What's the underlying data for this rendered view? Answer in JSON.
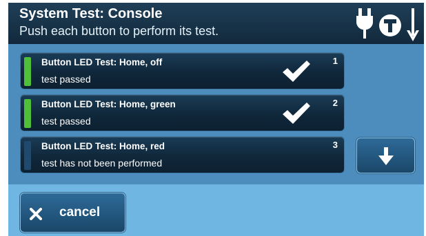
{
  "header": {
    "title": "System Test: Console",
    "subtitle": "Push each button to perform its test.",
    "icons": [
      "power-plug-icon",
      "t-circle-icon",
      "arrow-down-icon"
    ]
  },
  "tests": [
    {
      "title": "Button LED Test: Home, off",
      "status": "test passed",
      "number": "1",
      "state": "passed"
    },
    {
      "title": "Button LED Test: Home, green",
      "status": "test passed",
      "number": "2",
      "state": "passed"
    },
    {
      "title": "Button LED Test: Home, red",
      "status": "test has not been performed",
      "number": "3",
      "state": "pending"
    }
  ],
  "scroll": {
    "icon": "arrow-down-icon"
  },
  "footer": {
    "cancel_label": "cancel",
    "cancel_icon": "close-icon"
  },
  "colors": {
    "header_bg": "#163248",
    "panel_bg": "#4d8dbd",
    "screen_bg": "#6fb7e2",
    "status_passed": "#4fbf3a",
    "status_pending": "#1f4a6d"
  }
}
